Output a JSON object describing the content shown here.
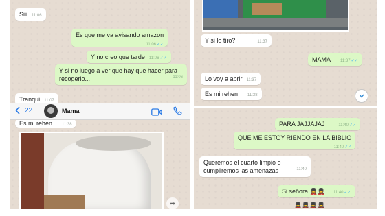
{
  "panel1": {
    "messages": [
      {
        "dir": "in",
        "text": "Siii",
        "time": "11:06"
      },
      {
        "dir": "out",
        "text": "Es que me va avisando amazon",
        "time": "11:06",
        "ticks": "✓✓"
      },
      {
        "dir": "out",
        "text": "Y no creo que tarde",
        "time": "11:06",
        "ticks": "✓✓"
      },
      {
        "dir": "out",
        "text": "Y si no luego a ver que hay que hacer para recogerlo...",
        "time": "11:06",
        "ticks": "✓✓"
      },
      {
        "dir": "in",
        "text": "Tranqui",
        "time": "11:07"
      }
    ]
  },
  "panel2": {
    "messages": [
      {
        "dir": "in",
        "text": "Y si lo tiro?",
        "time": "11:37"
      },
      {
        "dir": "out",
        "text": "MAMA",
        "time": "11:37",
        "ticks": "✓✓"
      },
      {
        "dir": "in",
        "text": "Lo voy a abrir",
        "time": "11:37"
      },
      {
        "dir": "in",
        "text": "Es mi rehen",
        "time": "11:38"
      }
    ]
  },
  "header": {
    "back_count": "22",
    "contact_name": "Mama"
  },
  "panel3": {
    "messages": [
      {
        "dir": "in",
        "text": "Es mi rehen",
        "time": "11:38"
      }
    ]
  },
  "panel4": {
    "messages": [
      {
        "dir": "out",
        "text": "PARA JAJJAJAJ",
        "time": "11:40",
        "ticks": "✓✓"
      },
      {
        "dir": "out",
        "text": "QUE ME ESTOY RIENDO EN LA BIBLIO",
        "time": "11:40",
        "ticks": "✓✓"
      },
      {
        "dir": "in",
        "text": "Queremos el cuarto limpio o cumpliremos las amenazas",
        "time": "11:40"
      },
      {
        "dir": "out",
        "text": "Si señora 💂💂",
        "time": "11:40",
        "ticks": "✓✓"
      },
      {
        "dir": "out",
        "text": "💂💂💂💂",
        "time": "",
        "ticks": ""
      }
    ]
  },
  "icons": {
    "back": "chevron-left-icon",
    "video": "video-camera-icon",
    "call": "phone-icon",
    "scroll_down": "chevron-down-icon",
    "share": "share-icon"
  },
  "colors": {
    "chat_bg": "#e6dcd2",
    "incoming": "#ffffff",
    "outgoing": "#dcf8c6",
    "link_blue": "#2b7be6",
    "read_tick": "#4fb6ec"
  }
}
